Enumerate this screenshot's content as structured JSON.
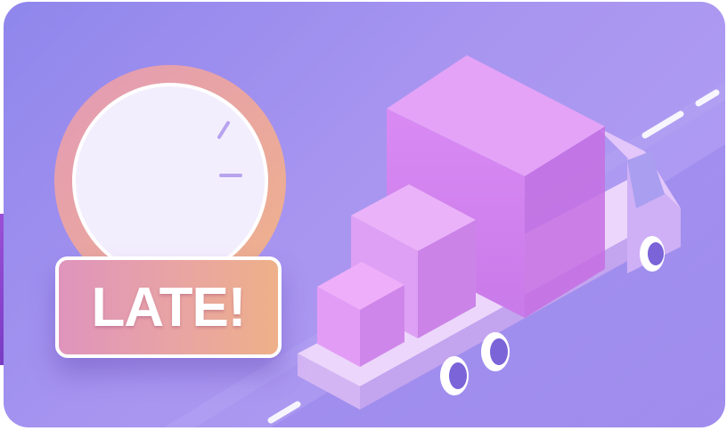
{
  "badge": {
    "text": "LATE!"
  },
  "colors": {
    "background_top": "#8f86ec",
    "background_bottom": "#b39ff3",
    "box_pink": "#dd86f2",
    "truck_body": "#e6ccfa",
    "wheel": "#7b63d8",
    "badge_gradient_start": "#df94bd",
    "badge_gradient_end": "#eeb089",
    "clock_face": "#f3eefe",
    "clock_ring": "#eba790"
  },
  "icons": {
    "clock": "stopwatch-icon",
    "vehicle": "delivery-truck-icon"
  }
}
